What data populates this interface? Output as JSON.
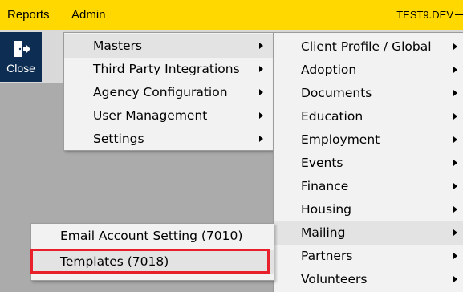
{
  "menubar": {
    "items": [
      "Reports",
      "Admin"
    ],
    "environment": "TEST9.DEV"
  },
  "toolbar": {
    "close_label": "Close",
    "close_icon": "exit-door-icon"
  },
  "admin_menu": {
    "items": [
      {
        "label": "Masters",
        "submenu": true,
        "highlighted": true
      },
      {
        "label": "Third Party Integrations",
        "submenu": true
      },
      {
        "label": "Agency Configuration",
        "submenu": true
      },
      {
        "label": "User Management",
        "submenu": true
      },
      {
        "label": "Settings",
        "submenu": true
      }
    ]
  },
  "masters_menu": {
    "items": [
      {
        "label": "Client Profile / Global",
        "submenu": true
      },
      {
        "label": "Adoption",
        "submenu": true
      },
      {
        "label": "Documents",
        "submenu": true
      },
      {
        "label": "Education",
        "submenu": true
      },
      {
        "label": "Employment",
        "submenu": true
      },
      {
        "label": "Events",
        "submenu": true
      },
      {
        "label": "Finance",
        "submenu": true
      },
      {
        "label": "Housing",
        "submenu": true
      },
      {
        "label": "Mailing",
        "submenu": true,
        "highlighted": true
      },
      {
        "label": "Partners",
        "submenu": true
      },
      {
        "label": "Volunteers",
        "submenu": true
      }
    ]
  },
  "mailing_menu": {
    "items": [
      {
        "label": "Email Account Setting (7010)"
      },
      {
        "label": "Templates (7018)",
        "highlighted": true
      }
    ]
  },
  "colors": {
    "menubar": "#ffd800",
    "close_button": "#0d2d52",
    "callout_border": "#e8202b",
    "menu_background": "#f2f2f2",
    "workspace": "#ababab"
  }
}
